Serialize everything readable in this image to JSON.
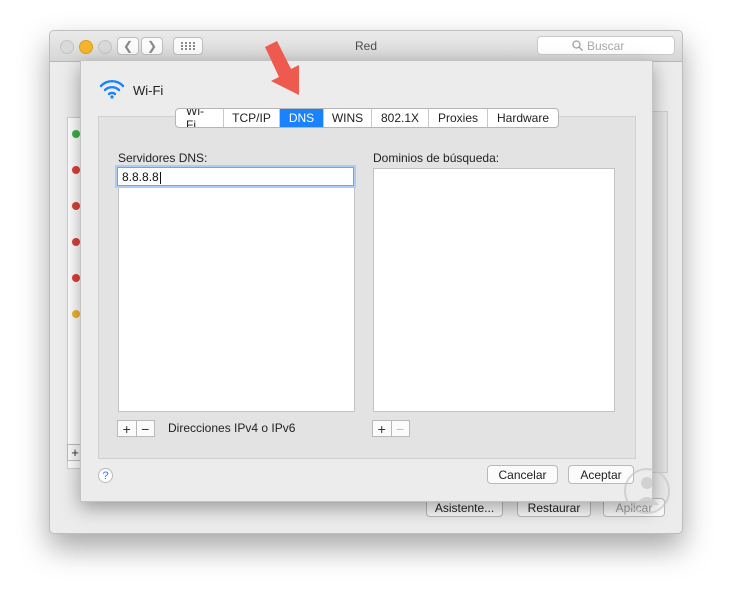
{
  "window": {
    "title": "Red",
    "search_placeholder": "Buscar",
    "buttons": {
      "assistant": "Asistente...",
      "restore": "Restaurar",
      "apply": "Aplicar"
    }
  },
  "sheet": {
    "interface_label": "Wi-Fi",
    "tabs": [
      {
        "label": "Wi-Fi",
        "active": false
      },
      {
        "label": "TCP/IP",
        "active": false
      },
      {
        "label": "DNS",
        "active": true
      },
      {
        "label": "WINS",
        "active": false
      },
      {
        "label": "802.1X",
        "active": false
      },
      {
        "label": "Proxies",
        "active": false
      },
      {
        "label": "Hardware",
        "active": false
      }
    ],
    "dns_servers": {
      "label": "Servidores DNS:",
      "entries": [
        "8.8.8.8"
      ],
      "hint": "Direcciones IPv4 o IPv6"
    },
    "search_domains": {
      "label": "Dominios de búsqueda:",
      "entries": []
    },
    "add_symbol": "+",
    "remove_symbol": "−",
    "help_symbol": "?",
    "cancel_label": "Cancelar",
    "accept_label": "Aceptar"
  },
  "sidebar_status_colors": [
    "#39b54a",
    "#e0403a",
    "#e0403a",
    "#e0403a",
    "#e0403a",
    "#f2b632"
  ],
  "colors": {
    "accent": "#1a82fb",
    "arrow": "#ef5a4e"
  }
}
